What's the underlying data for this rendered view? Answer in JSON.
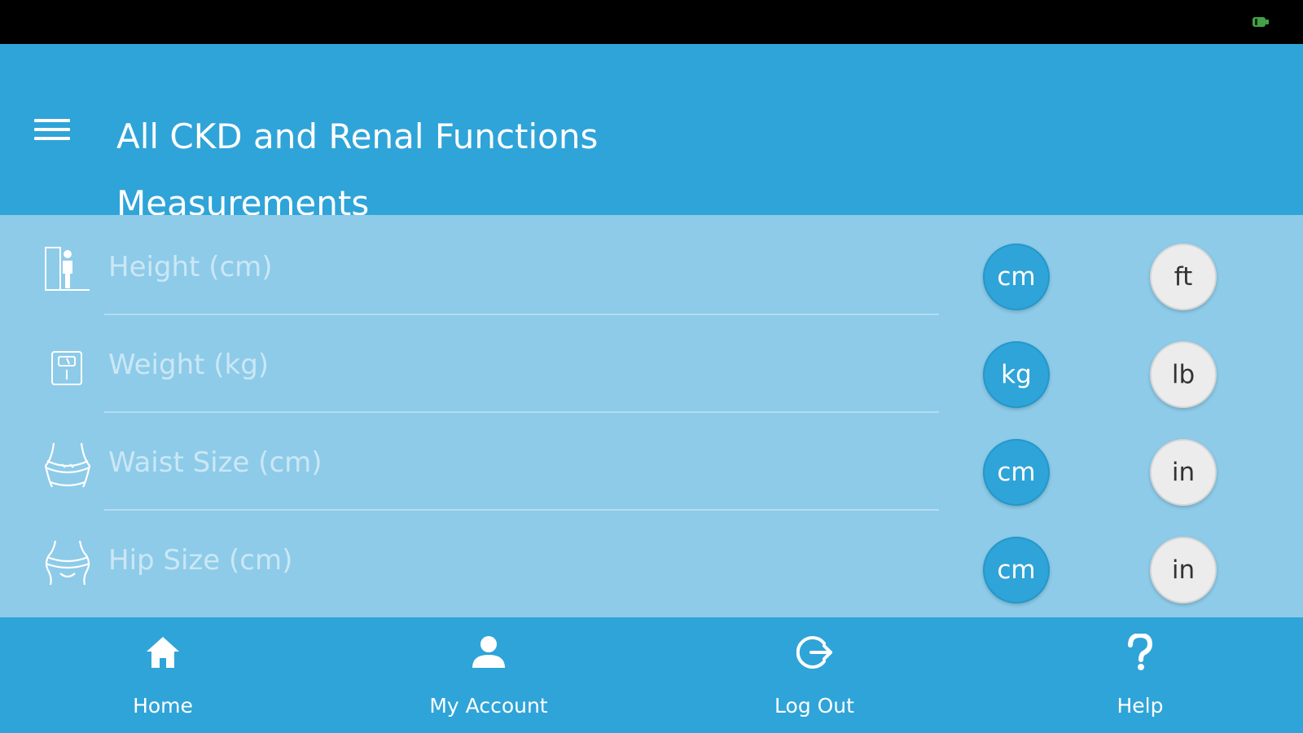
{
  "app_bar": {
    "title": "All CKD and Renal Functions",
    "subtitle": "Measurements",
    "menu_icon": "hamburger-menu-icon"
  },
  "measurements": [
    {
      "label": "Height (cm)",
      "icon": "height-icon",
      "units": [
        "cm",
        "ft"
      ],
      "selected_unit": "cm"
    },
    {
      "label": "Weight (kg)",
      "icon": "scale-icon",
      "units": [
        "kg",
        "lb"
      ],
      "selected_unit": "kg"
    },
    {
      "label": "Waist Size (cm)",
      "icon": "waist-icon",
      "units": [
        "cm",
        "in"
      ],
      "selected_unit": "cm"
    },
    {
      "label": "Hip Size (cm)",
      "icon": "hip-icon",
      "units": [
        "cm",
        "in"
      ],
      "selected_unit": "cm"
    }
  ],
  "bottom_nav": [
    {
      "label": "Home",
      "icon": "home-icon"
    },
    {
      "label": "My Account",
      "icon": "account-icon"
    },
    {
      "label": "Log Out",
      "icon": "logout-icon"
    },
    {
      "label": "Help",
      "icon": "help-icon"
    }
  ],
  "colors": {
    "primary": "#2FA4D8",
    "content_background": "#8DCBE9",
    "status_bar": "#000000",
    "battery": "#43A047",
    "secondary_button": "#ECECEC"
  }
}
